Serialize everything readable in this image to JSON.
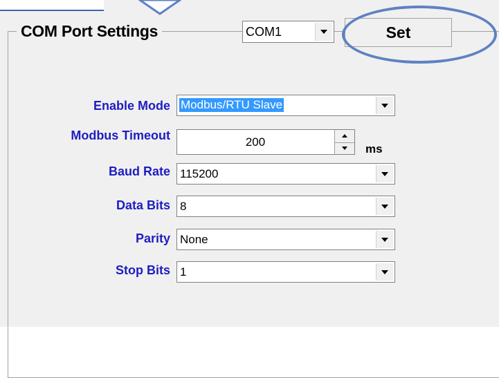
{
  "group": {
    "title": "COM Port Settings"
  },
  "com_port": {
    "value": "COM1"
  },
  "set_button": {
    "label": "Set"
  },
  "enable_mode": {
    "label": "Enable Mode",
    "value": "Modbus/RTU Slave"
  },
  "modbus_timeout": {
    "label": "Modbus Timeout",
    "value": "200",
    "unit": "ms"
  },
  "baud_rate": {
    "label": "Baud Rate",
    "value": "115200"
  },
  "data_bits": {
    "label": "Data Bits",
    "value": "8"
  },
  "parity": {
    "label": "Parity",
    "value": "None"
  },
  "stop_bits": {
    "label": "Stop Bits",
    "value": "1"
  },
  "colors": {
    "label_blue": "#1d1dc2",
    "highlight": "#5e82c2",
    "selection": "#3399ff"
  },
  "icons": {
    "dropdown": "chevron-down-icon",
    "spin_up": "arrow-up-icon",
    "spin_down": "arrow-down-icon"
  }
}
